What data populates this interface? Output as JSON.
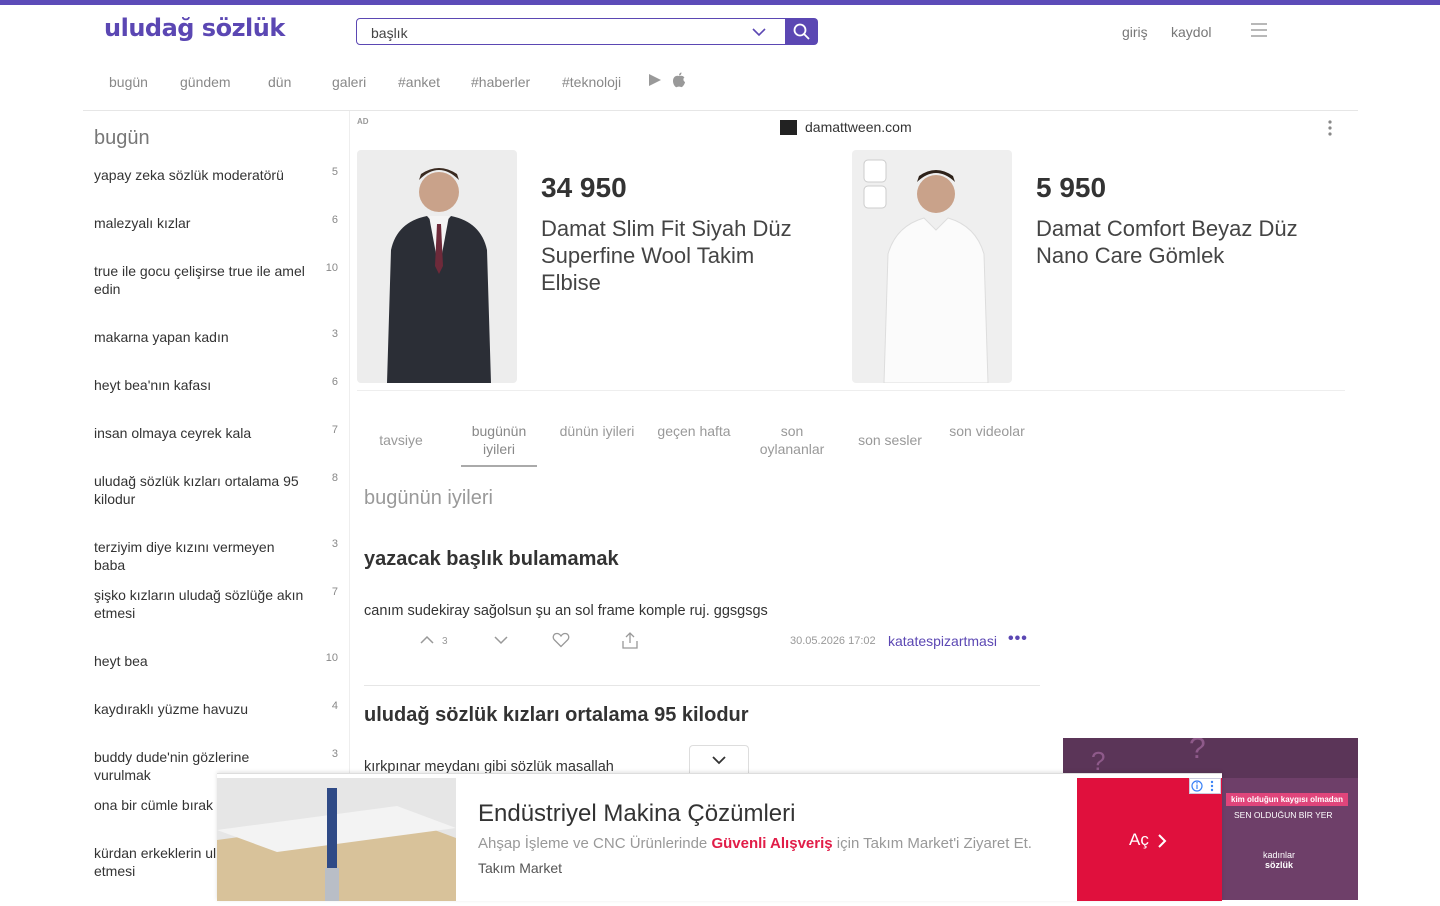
{
  "header": {
    "logo": "uludağ sözlük",
    "search_value": "başlık",
    "login": "giriş",
    "register": "kaydol"
  },
  "nav": [
    "bugün",
    "gündem",
    "dün",
    "galeri",
    "#anket",
    "#haberler",
    "#teknoloji"
  ],
  "sidebar": {
    "title": "bugün",
    "items": [
      {
        "label": "yapay zeka sözlük moderatörü",
        "count": "5"
      },
      {
        "label": "malezyalı kızlar",
        "count": "6"
      },
      {
        "label": "true ile gocu çelişirse true ile amel edin",
        "count": "10"
      },
      {
        "label": "makarna yapan kadın",
        "count": "3"
      },
      {
        "label": "heyt bea'nın kafası",
        "count": "6"
      },
      {
        "label": "insan olmaya ceyrek kala",
        "count": "7"
      },
      {
        "label": "uludağ sözlük kızları ortalama 95 kilodur",
        "count": "8"
      },
      {
        "label": "terziyim diye kızını vermeyen baba",
        "count": "3"
      },
      {
        "label": "şişko kızların uludağ sözlüğe akın etmesi",
        "count": "7"
      },
      {
        "label": "heyt bea",
        "count": "10"
      },
      {
        "label": "kaydıraklı yüzme havuzu",
        "count": "4"
      },
      {
        "label": "buddy dude'nin gözlerine vurulmak",
        "count": "3"
      },
      {
        "label": "ona bir cümle bırak",
        "count": ""
      },
      {
        "label": "kürdan erkeklerin ul etmesi",
        "count": ""
      }
    ]
  },
  "ad": {
    "tag": "AD",
    "domain": "damattween.com",
    "products": [
      {
        "price": "34 950",
        "name": "Damat Slim Fit Siyah Düz Superfine Wool Takim Elbise"
      },
      {
        "price": "5 950",
        "name": "Damat Comfort Beyaz Düz Nano Care Gömlek"
      }
    ]
  },
  "tabs": [
    {
      "label": "tavsiye"
    },
    {
      "label": "bugünün iyileri"
    },
    {
      "label": "dünün iyileri"
    },
    {
      "label": "geçen hafta"
    },
    {
      "label": "son oylananlar"
    },
    {
      "label": "son sesler"
    },
    {
      "label": "son videolar"
    }
  ],
  "section_title": "bugünün iyileri",
  "entries": [
    {
      "title": "yazacak başlık bulamamak",
      "text": "canım sudekiray sağolsun şu an sol frame komple ruj. ggsgsgs",
      "votes": "3",
      "date": "30.05.2026 17:02",
      "author": "katatespizartmasi",
      "more": "•••"
    },
    {
      "title": "uludağ sözlük kızları ortalama 95 kilodur",
      "text": "kırkpınar meydanı gibi sözlük masallah"
    }
  ],
  "bottom_banner": {
    "title": "Endüstriyel Makina Çözümleri",
    "desc_before": "Ahşap İşleme ve CNC Ürünlerinde ",
    "desc_highlight": "Güvenli Alışveriş",
    "desc_after": " için Takım Market'i Ziyaret Et.",
    "brand": "Takım Market",
    "cta": "Aç"
  },
  "side_ad": {
    "tag": "kim olduğun kaygısı olmadan",
    "line": "SEN OLDUĞUN BİR YER",
    "brand_line1": "kadınlar",
    "brand_line2": "sözlük"
  },
  "colors": {
    "accent": "#5b47b3",
    "topbar": "#5c4bb8",
    "cta": "#e0103d",
    "side_ad_bg": "#5b3558"
  }
}
